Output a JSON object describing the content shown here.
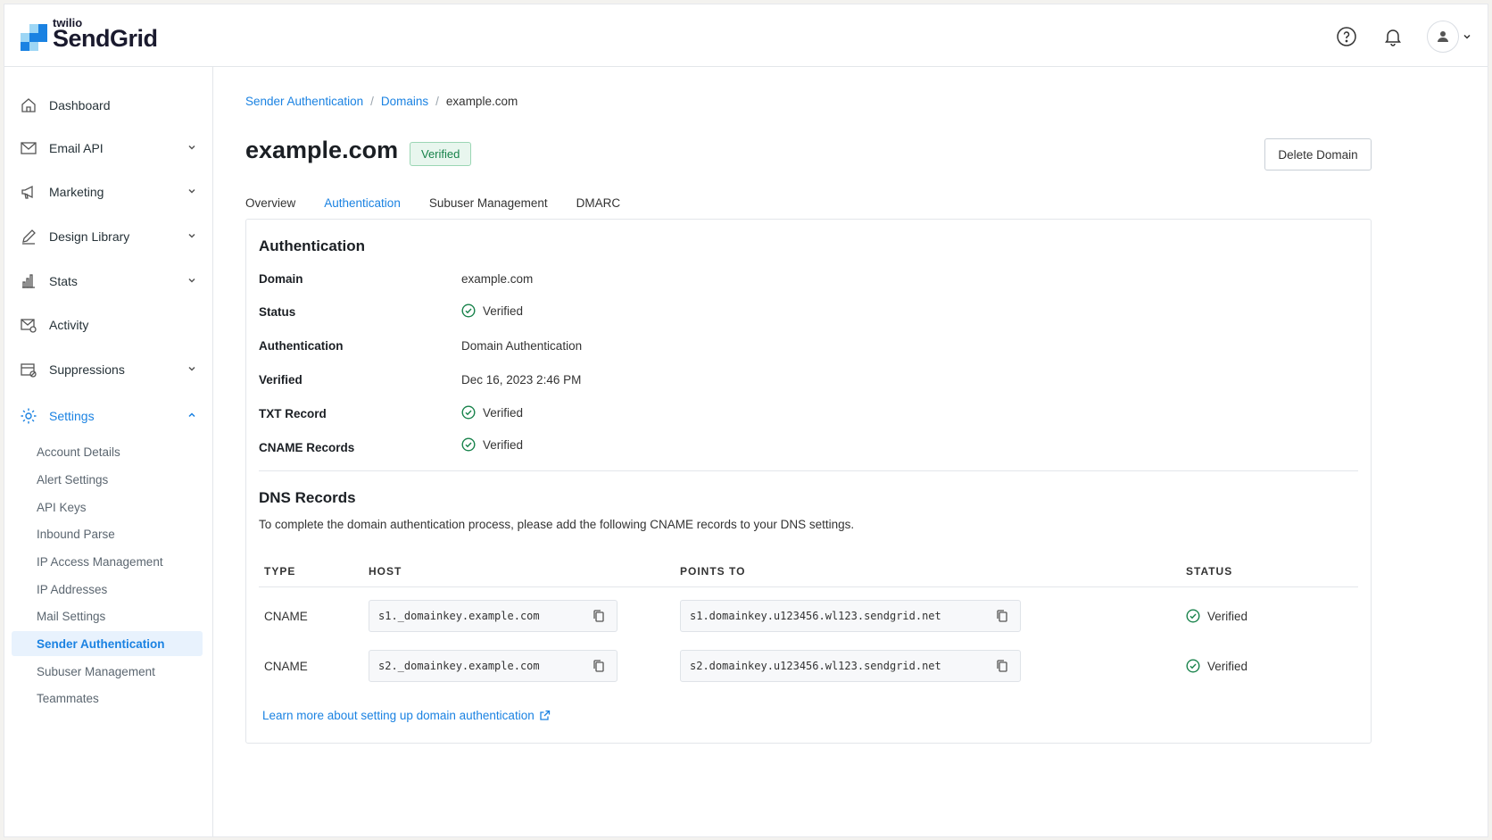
{
  "app": {
    "logo_small": "twilio",
    "logo_big": "SendGrid"
  },
  "topbar": {
    "help_icon": "question-circle-icon",
    "notifications_icon": "bell-icon",
    "avatar_icon": "user-icon"
  },
  "sidebar": {
    "items": [
      {
        "label": "Dashboard",
        "icon": "home-icon"
      },
      {
        "label": "Email API",
        "icon": "envelope-icon"
      },
      {
        "label": "Marketing",
        "icon": "megaphone-icon"
      },
      {
        "label": "Design Library",
        "icon": "pencil-icon"
      },
      {
        "label": "Stats",
        "icon": "bar-chart-icon"
      },
      {
        "label": "Activity",
        "icon": "mail-activity-icon"
      },
      {
        "label": "Suppressions",
        "icon": "calendar-block-icon"
      },
      {
        "label": "Settings",
        "icon": "gear-icon"
      }
    ],
    "settings_subitems": [
      "Account Details",
      "Alert Settings",
      "API Keys",
      "Inbound Parse",
      "IP Access Management",
      "IP Addresses",
      "Mail Settings",
      "Sender Authentication",
      "Subuser Management",
      "Teammates"
    ],
    "active_subitem": "Sender Authentication"
  },
  "breadcrumb": {
    "items": [
      "Sender Authentication",
      "Domains"
    ],
    "current": "example.com",
    "separator": "/"
  },
  "page": {
    "title": "example.com",
    "badge": "Verified",
    "delete_button": "Delete Domain"
  },
  "tabs": [
    {
      "label": "Overview",
      "active": false
    },
    {
      "label": "Authentication",
      "active": true
    },
    {
      "label": "Subuser Management",
      "active": false
    },
    {
      "label": "DMARC",
      "active": false
    }
  ],
  "authentication": {
    "title": "Authentication",
    "rows": [
      {
        "label": "Domain",
        "value": "example.com",
        "check": false
      },
      {
        "label": "Status",
        "value": "Verified",
        "check": true
      },
      {
        "label": "Authentication",
        "value": "Domain Authentication",
        "check": false
      },
      {
        "label": "Verified",
        "value": "Dec 16, 2023 2:46 PM",
        "check": false
      },
      {
        "label": "TXT Record",
        "value": "Verified",
        "check": true
      },
      {
        "label": "CNAME Records",
        "value": "Verified",
        "check": true
      }
    ]
  },
  "dns": {
    "title": "DNS Records",
    "description": "To complete the domain authentication process, please add the following CNAME records to your DNS settings.",
    "columns": [
      "TYPE",
      "HOST",
      "POINTS TO",
      "STATUS"
    ],
    "rows": [
      {
        "type": "CNAME",
        "host": "s1._domainkey.example.com",
        "points_to": "s1.domainkey.u123456.wl123.sendgrid.net",
        "status": "Verified"
      },
      {
        "type": "CNAME",
        "host": "s2._domainkey.example.com",
        "points_to": "s2.domainkey.u123456.wl123.sendgrid.net",
        "status": "Verified"
      }
    ],
    "learn_more": "Learn more about setting up domain authentication"
  },
  "colors": {
    "accent": "#1a82e2",
    "success": "#17824a",
    "success_bg": "#e8f6ee"
  }
}
